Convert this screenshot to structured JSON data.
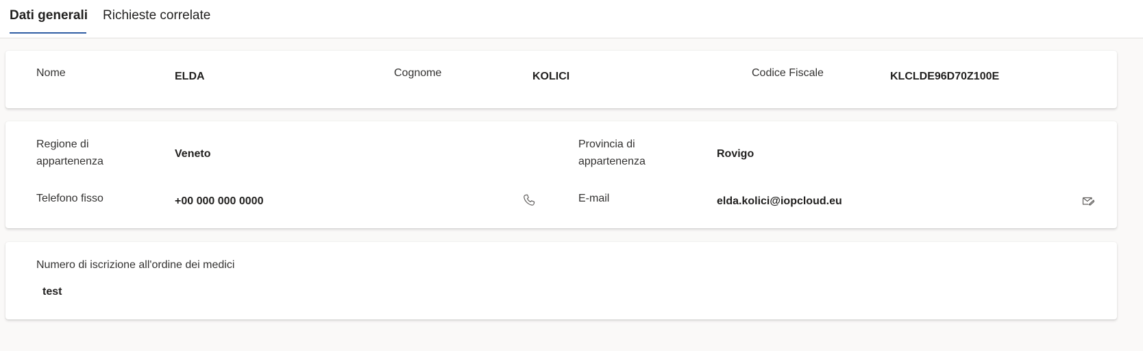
{
  "tabs": [
    {
      "label": "Dati generali",
      "active": true
    },
    {
      "label": "Richieste correlate",
      "active": false
    }
  ],
  "anagrafica": {
    "nome_label": "Nome",
    "nome_value": "ELDA",
    "cognome_label": "Cognome",
    "cognome_value": "KOLICI",
    "codice_fiscale_label": "Codice Fiscale",
    "codice_fiscale_value": "KLCLDE96D70Z100E"
  },
  "contatti": {
    "regione_label_line1": "Regione di",
    "regione_label_line2": "appartenenza",
    "regione_value": "Veneto",
    "provincia_label_line1": "Provincia di",
    "provincia_label_line2": "appartenenza",
    "provincia_value": "Rovigo",
    "telefono_label": "Telefono fisso",
    "telefono_value": "+00 000 000 0000",
    "telefono_icon": "phone-icon",
    "email_label": "E-mail",
    "email_value": "elda.kolici@iopcloud.eu",
    "email_icon": "mail-send-icon"
  },
  "iscrizione": {
    "label": "Numero di iscrizione all'ordine dei medici",
    "value": "test"
  },
  "colors": {
    "accent": "#2f5da3",
    "background": "#faf9f8",
    "card": "#ffffff",
    "text": "#323130"
  }
}
